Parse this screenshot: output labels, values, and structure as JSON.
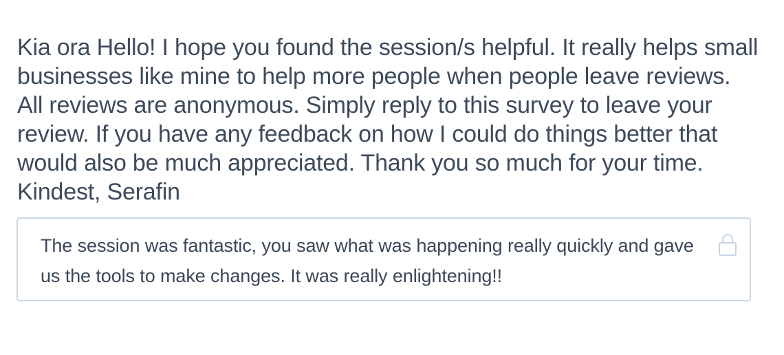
{
  "survey": {
    "question": "Kia ora Hello! I hope you found the session/s helpful. It really helps small businesses like mine to help more people when people leave reviews. All reviews are anonymous. Simply reply to this survey to leave your review. If you have any feedback on how I could do things better that would also be much appreciated. Thank you so much for your time. Kindest, Serafin",
    "answer": "The session was fantastic, you saw what was happening really quickly and gave us the tools to make changes. It was really enlightening!!",
    "lock_icon": "lock-icon",
    "colors": {
      "text": "#3c4a5c",
      "border": "#c9d8e6",
      "icon": "#c5d5e4"
    }
  }
}
